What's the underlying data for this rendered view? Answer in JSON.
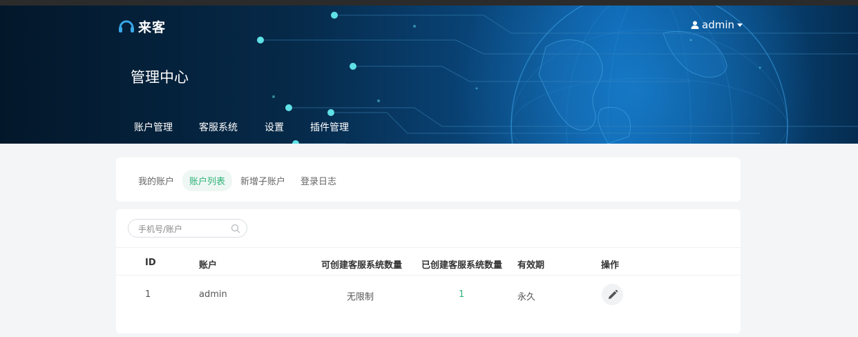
{
  "app": {
    "logo_text": "来客"
  },
  "header": {
    "user_name": "admin",
    "title": "管理中心",
    "nav": [
      "账户管理",
      "客服系统",
      "设置",
      "插件管理"
    ]
  },
  "tabs": [
    {
      "label": "我的账户",
      "active": false
    },
    {
      "label": "账户列表",
      "active": true
    },
    {
      "label": "新增子账户",
      "active": false
    },
    {
      "label": "登录日志",
      "active": false
    }
  ],
  "search": {
    "placeholder": "手机号/账户",
    "value": ""
  },
  "table": {
    "columns": [
      "ID",
      "账户",
      "可创建客服系统数量",
      "已创建客服系统数量",
      "有效期",
      "操作"
    ],
    "rows": [
      {
        "id": "1",
        "account": "admin",
        "can_create": "无限制",
        "created": "1",
        "validity": "永久"
      }
    ]
  },
  "colors": {
    "accent": "#2fb37a",
    "banner_dark": "#03172a",
    "banner_light": "#0b5ea8"
  },
  "icons": {
    "user": "user-icon",
    "caret": "chevron-down-icon",
    "search": "search-icon",
    "edit": "pencil-icon",
    "logo": "headset-icon"
  }
}
